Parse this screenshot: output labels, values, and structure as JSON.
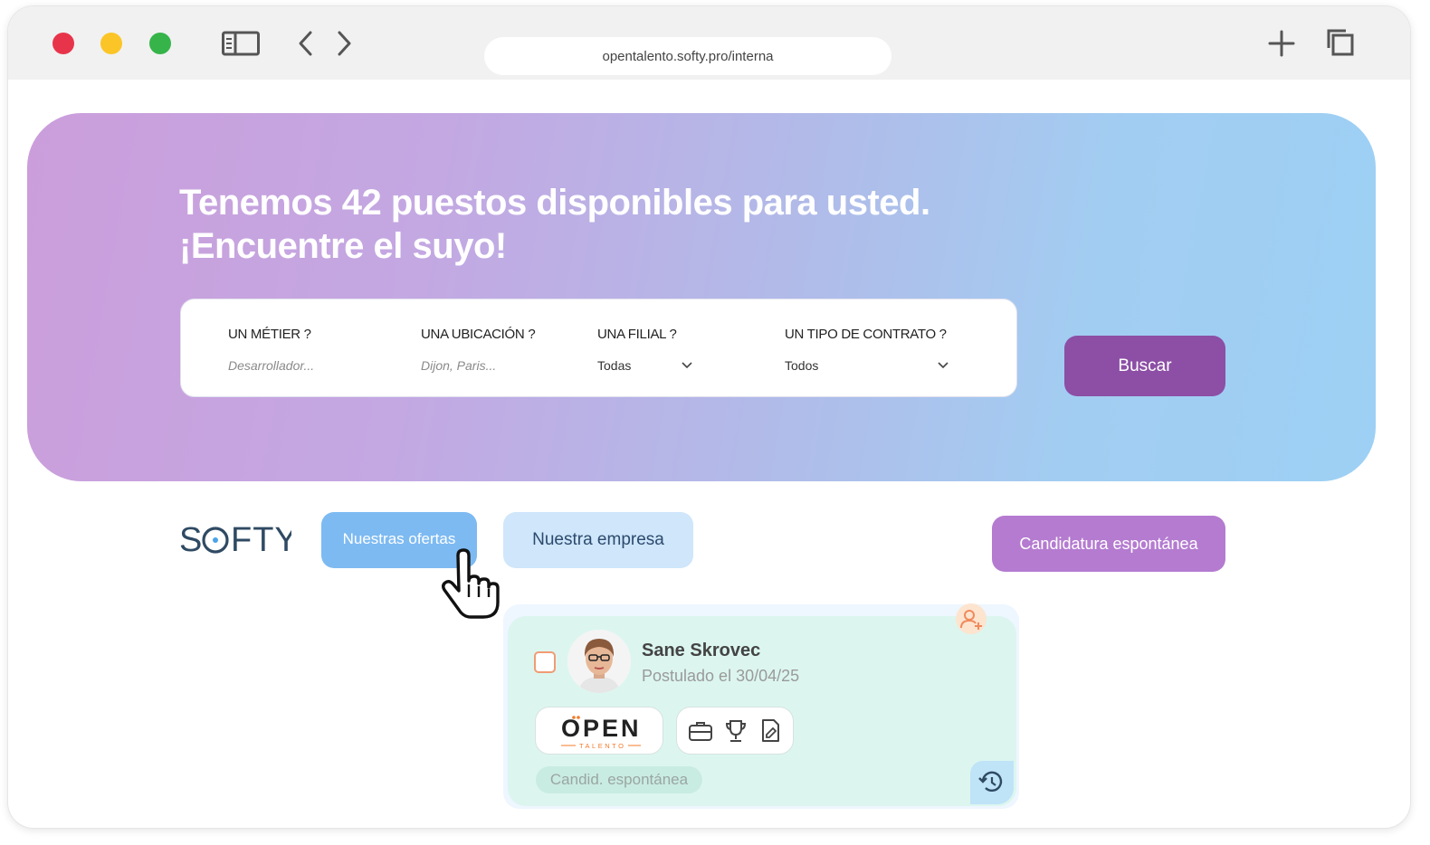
{
  "browser": {
    "url": "opentalento.softy.pro/interna"
  },
  "hero": {
    "title_line1": "Tenemos 42 puestos disponibles para usted.",
    "title_line2": "¡Encuentre el suyo!",
    "fields": {
      "metier": {
        "label": "UN MÉTIER ?",
        "placeholder": "Desarrollador..."
      },
      "ubicacion": {
        "label": "UNA UBICACIÓN ?",
        "placeholder": "Dijon, Paris..."
      },
      "filial": {
        "label": "UNA FILIAL ?",
        "value": "Todas"
      },
      "contrato": {
        "label": "UN TIPO DE CONTRATO ?",
        "value": "Todos"
      }
    },
    "search_button": "Buscar"
  },
  "nav": {
    "logo": "SOFTY",
    "ofertas": "Nuestras ofertas",
    "empresa": "Nuestra empresa",
    "espontanea": "Candidatura espontánea"
  },
  "candidate": {
    "name": "Sane Skrovec",
    "applied": "Postulado el 30/04/25",
    "source_logo": "OPEN",
    "source_logo_sub": "TALENTO",
    "tag": "Candid. espontánea"
  },
  "colors": {
    "hero_gradient_start": "#cb9edb",
    "hero_gradient_end": "#9dd0f4",
    "search_button": "#8c4fa5",
    "ofertas": "#7dbaf2",
    "empresa": "#cfe6fb",
    "espontanea": "#b47bd0",
    "card": "#dcf6ef"
  }
}
